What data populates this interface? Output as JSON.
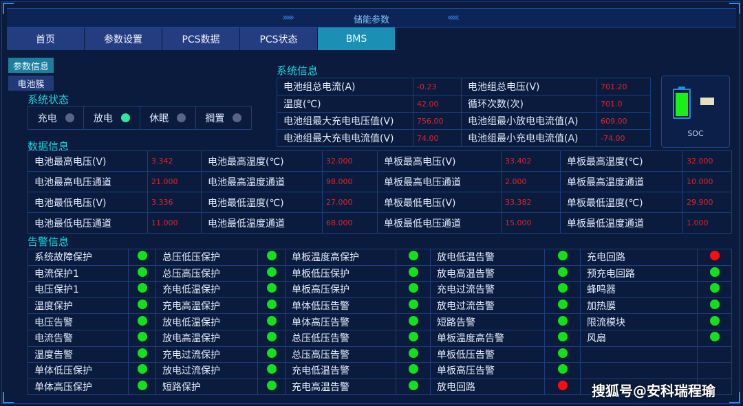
{
  "header": {
    "title": "储能参数",
    "arrows_left": "›››››",
    "arrows_right": "‹‹‹‹‹"
  },
  "nav": {
    "tabs": [
      {
        "label": "首页",
        "active": false
      },
      {
        "label": "参数设置",
        "active": false
      },
      {
        "label": "PCS数据",
        "active": false
      },
      {
        "label": "PCS状态",
        "active": false
      },
      {
        "label": "BMS",
        "active": true
      }
    ]
  },
  "subnav": {
    "param_info": "参数信息",
    "cluster": "电池簇"
  },
  "system_status": {
    "title": "系统状态",
    "items": [
      {
        "label": "充电",
        "on": false
      },
      {
        "label": "放电",
        "on": true
      },
      {
        "label": "休眠",
        "on": false
      },
      {
        "label": "搁置",
        "on": false
      }
    ]
  },
  "system_info": {
    "title": "系统信息",
    "rows": [
      [
        {
          "label": "电池组总电流(A)",
          "value": "-0.23"
        },
        {
          "label": "电池组总电压(V)",
          "value": "701.20"
        }
      ],
      [
        {
          "label": "温度(℃)",
          "value": "42.00"
        },
        {
          "label": "循环次数(次)",
          "value": "701.0"
        }
      ],
      [
        {
          "label": "电池组最大充电电压值(V)",
          "value": "756.00"
        },
        {
          "label": "电池组最小放电电流值(A)",
          "value": "609.00"
        }
      ],
      [
        {
          "label": "电池组最大充电电流值(V)",
          "value": "74.00"
        },
        {
          "label": "电池组最小充电电流值(A)",
          "value": "-74.00"
        }
      ]
    ]
  },
  "soc": {
    "label": "SOC"
  },
  "data_info": {
    "title": "数据信息",
    "rows": [
      [
        {
          "label": "电池最高电压(V)",
          "value": "3.342"
        },
        {
          "label": "电池最高温度(℃)",
          "value": "32.000"
        },
        {
          "label": "单板最高电压(V)",
          "value": "33.402"
        },
        {
          "label": "单板最高温度(℃)",
          "value": "32.000"
        }
      ],
      [
        {
          "label": "电池最高电压通道",
          "value": "21.000"
        },
        {
          "label": "电池最高温度通道",
          "value": "98.000"
        },
        {
          "label": "单板最高电压通道",
          "value": "2.000"
        },
        {
          "label": "单板最高温度通道",
          "value": "10.000"
        }
      ],
      [
        {
          "label": "电池最低电压(V)",
          "value": "3.336"
        },
        {
          "label": "电池最低温度(℃)",
          "value": "27.000"
        },
        {
          "label": "单板最低电压(V)",
          "value": "33.382"
        },
        {
          "label": "单板最低温度(℃)",
          "value": "29.900"
        }
      ],
      [
        {
          "label": "电池最低电压通道",
          "value": "11.000"
        },
        {
          "label": "电池最低温度通道",
          "value": "68.000"
        },
        {
          "label": "单板最低电压通道",
          "value": "15.000"
        },
        {
          "label": "单板最低温度通道",
          "value": "1.000"
        }
      ]
    ]
  },
  "alarm_info": {
    "title": "告警信息",
    "colors": {
      "ok": "#12e01a",
      "alarm": "#ff0d0d"
    },
    "columns": [
      [
        {
          "label": "系统故障保护",
          "status": "ok"
        },
        {
          "label": "电流保护1",
          "status": "ok"
        },
        {
          "label": "电压保护1",
          "status": "ok"
        },
        {
          "label": "温度保护",
          "status": "ok"
        },
        {
          "label": "电压告警",
          "status": "ok"
        },
        {
          "label": "电流告警",
          "status": "ok"
        },
        {
          "label": "温度告警",
          "status": "ok"
        },
        {
          "label": "单体低压保护",
          "status": "ok"
        },
        {
          "label": "单体高压保护",
          "status": "ok"
        }
      ],
      [
        {
          "label": "总压低压保护",
          "status": "ok"
        },
        {
          "label": "总压高压保护",
          "status": "ok"
        },
        {
          "label": "充电低温保护",
          "status": "ok"
        },
        {
          "label": "充电高温保护",
          "status": "ok"
        },
        {
          "label": "放电低温保护",
          "status": "ok"
        },
        {
          "label": "放电高温保护",
          "status": "ok"
        },
        {
          "label": "充电过流保护",
          "status": "ok"
        },
        {
          "label": "放电过流保护",
          "status": "ok"
        },
        {
          "label": "短路保护",
          "status": "ok"
        }
      ],
      [
        {
          "label": "单板温度高保护",
          "status": "ok"
        },
        {
          "label": "单板低压保护",
          "status": "ok"
        },
        {
          "label": "单板高压保护",
          "status": "ok"
        },
        {
          "label": "单体低压告警",
          "status": "ok"
        },
        {
          "label": "单体高压告警",
          "status": "ok"
        },
        {
          "label": "总压低压告警",
          "status": "ok"
        },
        {
          "label": "总压高压告警",
          "status": "ok"
        },
        {
          "label": "充电低温告警",
          "status": "ok"
        },
        {
          "label": "充电高温告警",
          "status": "ok"
        }
      ],
      [
        {
          "label": "放电低温告警",
          "status": "ok"
        },
        {
          "label": "放电高温告警",
          "status": "ok"
        },
        {
          "label": "充电过流告警",
          "status": "ok"
        },
        {
          "label": "放电过流告警",
          "status": "ok"
        },
        {
          "label": "短路告警",
          "status": "ok"
        },
        {
          "label": "单板温度高告警",
          "status": "ok"
        },
        {
          "label": "单板低压告警",
          "status": "ok"
        },
        {
          "label": "单板高压告警",
          "status": "ok"
        },
        {
          "label": "放电回路",
          "status": "alarm"
        }
      ],
      [
        {
          "label": "充电回路",
          "status": "alarm"
        },
        {
          "label": "预充电回路",
          "status": "ok"
        },
        {
          "label": "蜂鸣器",
          "status": "ok"
        },
        {
          "label": "加热膜",
          "status": "ok"
        },
        {
          "label": "限流模块",
          "status": "ok"
        },
        {
          "label": "风扇",
          "status": "ok"
        },
        {
          "label": "",
          "status": "none"
        },
        {
          "label": "",
          "status": "none"
        },
        {
          "label": "",
          "status": "none"
        }
      ]
    ]
  },
  "watermark": "搜狐号@安科瑞程瑜"
}
